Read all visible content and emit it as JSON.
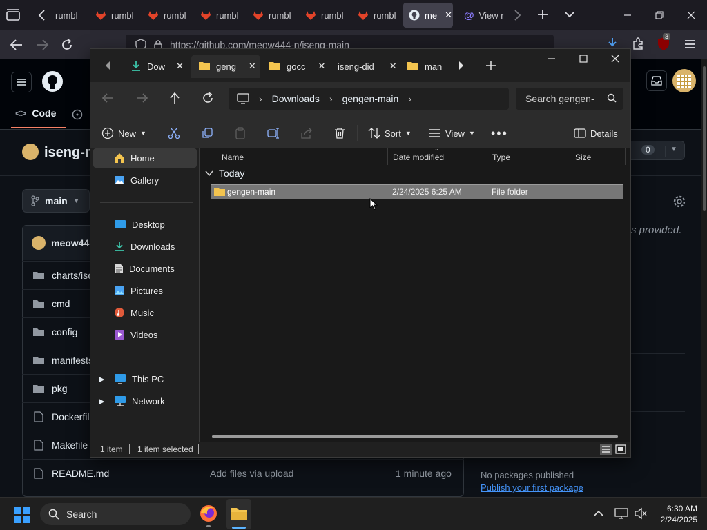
{
  "browser": {
    "tabs": [
      {
        "label": "rumbl",
        "icon": "gitlab-icon"
      },
      {
        "label": "rumbl",
        "icon": "gitlab-icon"
      },
      {
        "label": "rumbl",
        "icon": "gitlab-icon"
      },
      {
        "label": "rumbl",
        "icon": "gitlab-icon"
      },
      {
        "label": "rumbl",
        "icon": "gitlab-icon"
      },
      {
        "label": "rumbl",
        "icon": "gitlab-icon"
      },
      {
        "label": "rumbl",
        "icon": "gitlab-icon"
      },
      {
        "label": "me",
        "icon": "github-icon"
      },
      {
        "label": "View r",
        "icon": "at-icon"
      }
    ],
    "url": "https://github.com/meow444-n/iseng-main",
    "extension_badge": "3"
  },
  "github": {
    "nav_code": "Code",
    "repo_name": "iseng-m",
    "branch": "main",
    "owner_short": "meow44",
    "counter": "0",
    "about_text": "s provided.",
    "files": [
      "charts/ise",
      "cmd",
      "config",
      "manifests",
      "pkg",
      "Dockerfil",
      "Makefile",
      "README.md"
    ],
    "readme_commit": "Add files via upload",
    "readme_time": "1 minute ago",
    "packages_none": "No packages published",
    "packages_link": "Publish your first package"
  },
  "explorer": {
    "tabs": [
      {
        "label": "Dow",
        "icon": "download-icon"
      },
      {
        "label": "geng",
        "icon": "folder-icon"
      },
      {
        "label": "gocc",
        "icon": "folder-icon"
      },
      {
        "label": "iseng-did",
        "icon": ""
      },
      {
        "label": "man",
        "icon": "folder-icon"
      }
    ],
    "breadcrumb": [
      "Downloads",
      "gengen-main"
    ],
    "search_placeholder": "Search gengen-",
    "toolbar": {
      "new": "New",
      "sort": "Sort",
      "view": "View",
      "details": "Details"
    },
    "sidebar": {
      "top": [
        "Home",
        "Gallery"
      ],
      "quick": [
        "Desktop",
        "Downloads",
        "Documents",
        "Pictures",
        "Music",
        "Videos"
      ],
      "bottom": [
        "This PC",
        "Network"
      ]
    },
    "columns": {
      "name": "Name",
      "date": "Date modified",
      "type": "Type",
      "size": "Size"
    },
    "group": "Today",
    "rows": [
      {
        "name": "gengen-main",
        "date": "2/24/2025 6:25 AM",
        "type": "File folder",
        "size": ""
      }
    ],
    "status": {
      "count": "1 item",
      "selected": "1 item selected"
    }
  },
  "taskbar": {
    "search": "Search",
    "time": "6:30 AM",
    "date": "2/24/2025"
  }
}
